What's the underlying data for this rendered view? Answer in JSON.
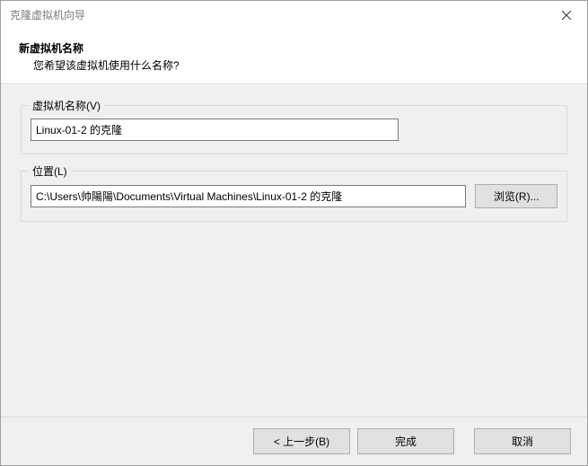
{
  "window": {
    "title": "克隆虚拟机向导"
  },
  "header": {
    "title": "新虚拟机名称",
    "subtitle": "您希望该虚拟机使用什么名称?"
  },
  "name_section": {
    "legend": "虚拟机名称(V)",
    "value": "Linux-01-2 的克隆"
  },
  "location_section": {
    "legend": "位置(L)",
    "value": "C:\\Users\\帅陽陽\\Documents\\Virtual Machines\\Linux-01-2 的克隆",
    "browse_label": "浏览(R)..."
  },
  "buttons": {
    "back": "< 上一步(B)",
    "finish": "完成",
    "cancel": "取消"
  }
}
